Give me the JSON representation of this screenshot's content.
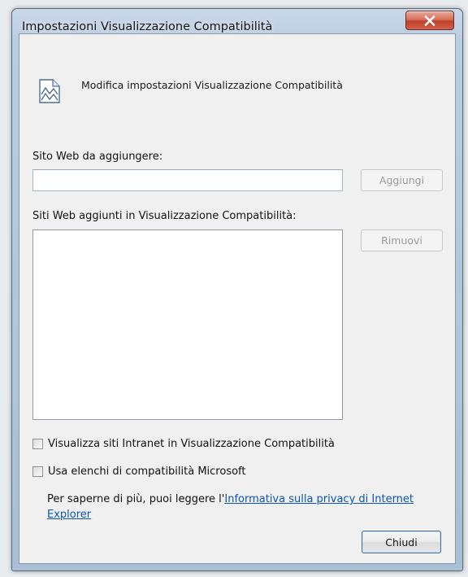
{
  "window": {
    "title": "Impostazioni Visualizzazione Compatibilità"
  },
  "header": {
    "text": "Modifica impostazioni Visualizzazione Compatibilità",
    "icon": "compatibility-view-icon"
  },
  "add_site": {
    "label": "Sito Web da aggiungere:",
    "value": "",
    "placeholder": "",
    "button_label": "Aggiungi",
    "button_enabled": false
  },
  "site_list": {
    "label": "Siti Web aggiunti in Visualizzazione Compatibilità:",
    "items": [],
    "remove_label": "Rimuovi",
    "remove_enabled": false
  },
  "options": {
    "intranet_label": "Visualizza siti Intranet in Visualizzazione Compatibilità",
    "intranet_checked": false,
    "microsoft_lists_label": "Usa elenchi di compatibilità Microsoft",
    "microsoft_lists_checked": false
  },
  "info": {
    "prefix": "Per saperne di più, puoi leggere l'",
    "link_text": "Informativa sulla privacy di Internet Explorer"
  },
  "footer": {
    "close_label": "Chiudi"
  },
  "colors": {
    "link": "#0a56b8",
    "close_button": "#c0402a",
    "title_bar": "#b9cde2"
  }
}
